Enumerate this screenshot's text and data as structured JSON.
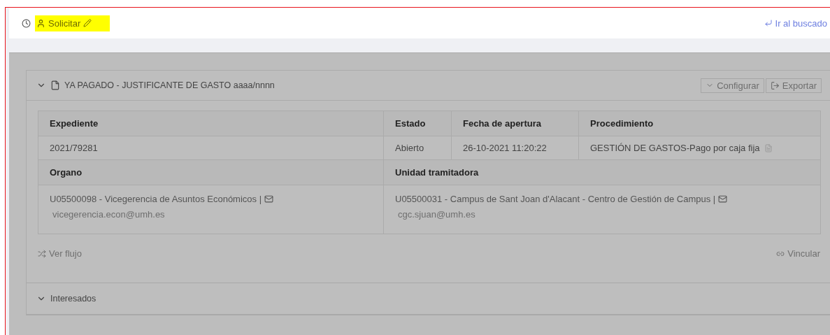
{
  "header": {
    "requester": "Solicitar",
    "back_link": "Ir al buscado"
  },
  "sections": [
    {
      "title": "YA PAGADO - JUSTIFICANTE DE GASTO aaaa/nnnn",
      "expanded": true,
      "buttons": [
        "Configurar",
        "Exportar"
      ],
      "table": {
        "row1_headers": [
          "Expediente",
          "Estado",
          "Fecha de apertura",
          "Procedimiento"
        ],
        "row1_values": [
          "2021/79281",
          "Abierto",
          "26-10-2021 11:20:22",
          "GESTIÓN DE GASTOS-Pago por caja fija"
        ],
        "row2_headers": [
          "Organo",
          "Unidad tramitadora"
        ],
        "row2_values": [
          {
            "name": "U05500098 - Vicegerencia de Asuntos Económicos |",
            "email": "vicegerencia.econ@umh.es"
          },
          {
            "name": "U05500031 - Campus de Sant Joan d'Alacant - Centro de Gestión de Campus |",
            "email": "cgc.sjuan@umh.es"
          }
        ]
      },
      "actions": [
        "Ver flujo",
        "Vincular"
      ]
    },
    {
      "title": "Interesados",
      "expanded": true
    }
  ]
}
